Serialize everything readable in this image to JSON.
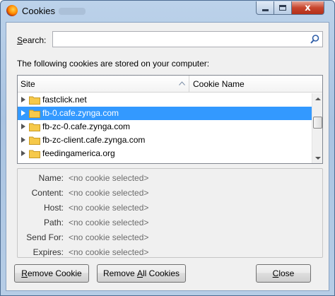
{
  "window": {
    "title": "Cookies",
    "close_glyph": "x"
  },
  "search": {
    "label_prefix": "",
    "label_access": "S",
    "label_rest": "earch:",
    "value": "",
    "placeholder": ""
  },
  "intro_text": "The following cookies are stored on your computer:",
  "tree": {
    "columns": [
      "Site",
      "Cookie Name"
    ],
    "rows": [
      {
        "label": "fastclick.net",
        "selected": false
      },
      {
        "label": "fb-0.cafe.zynga.com",
        "selected": true
      },
      {
        "label": "fb-zc-0.cafe.zynga.com",
        "selected": false
      },
      {
        "label": "fb-zc-client.cafe.zynga.com",
        "selected": false
      },
      {
        "label": "feedingamerica.org",
        "selected": false
      }
    ]
  },
  "details": {
    "fields": [
      {
        "label": "Name:",
        "value": "<no cookie selected>"
      },
      {
        "label": "Content:",
        "value": "<no cookie selected>"
      },
      {
        "label": "Host:",
        "value": "<no cookie selected>"
      },
      {
        "label": "Path:",
        "value": "<no cookie selected>"
      },
      {
        "label": "Send For:",
        "value": "<no cookie selected>"
      },
      {
        "label": "Expires:",
        "value": "<no cookie selected>"
      }
    ]
  },
  "buttons": {
    "remove_cookie": {
      "access": "R",
      "rest": "emove Cookie"
    },
    "remove_all": {
      "before": "Remove ",
      "access": "A",
      "rest": "ll Cookies"
    },
    "close": {
      "access": "C",
      "rest": "lose"
    }
  },
  "colors": {
    "selection": "#3399ff",
    "folder": "#f6c94a"
  }
}
